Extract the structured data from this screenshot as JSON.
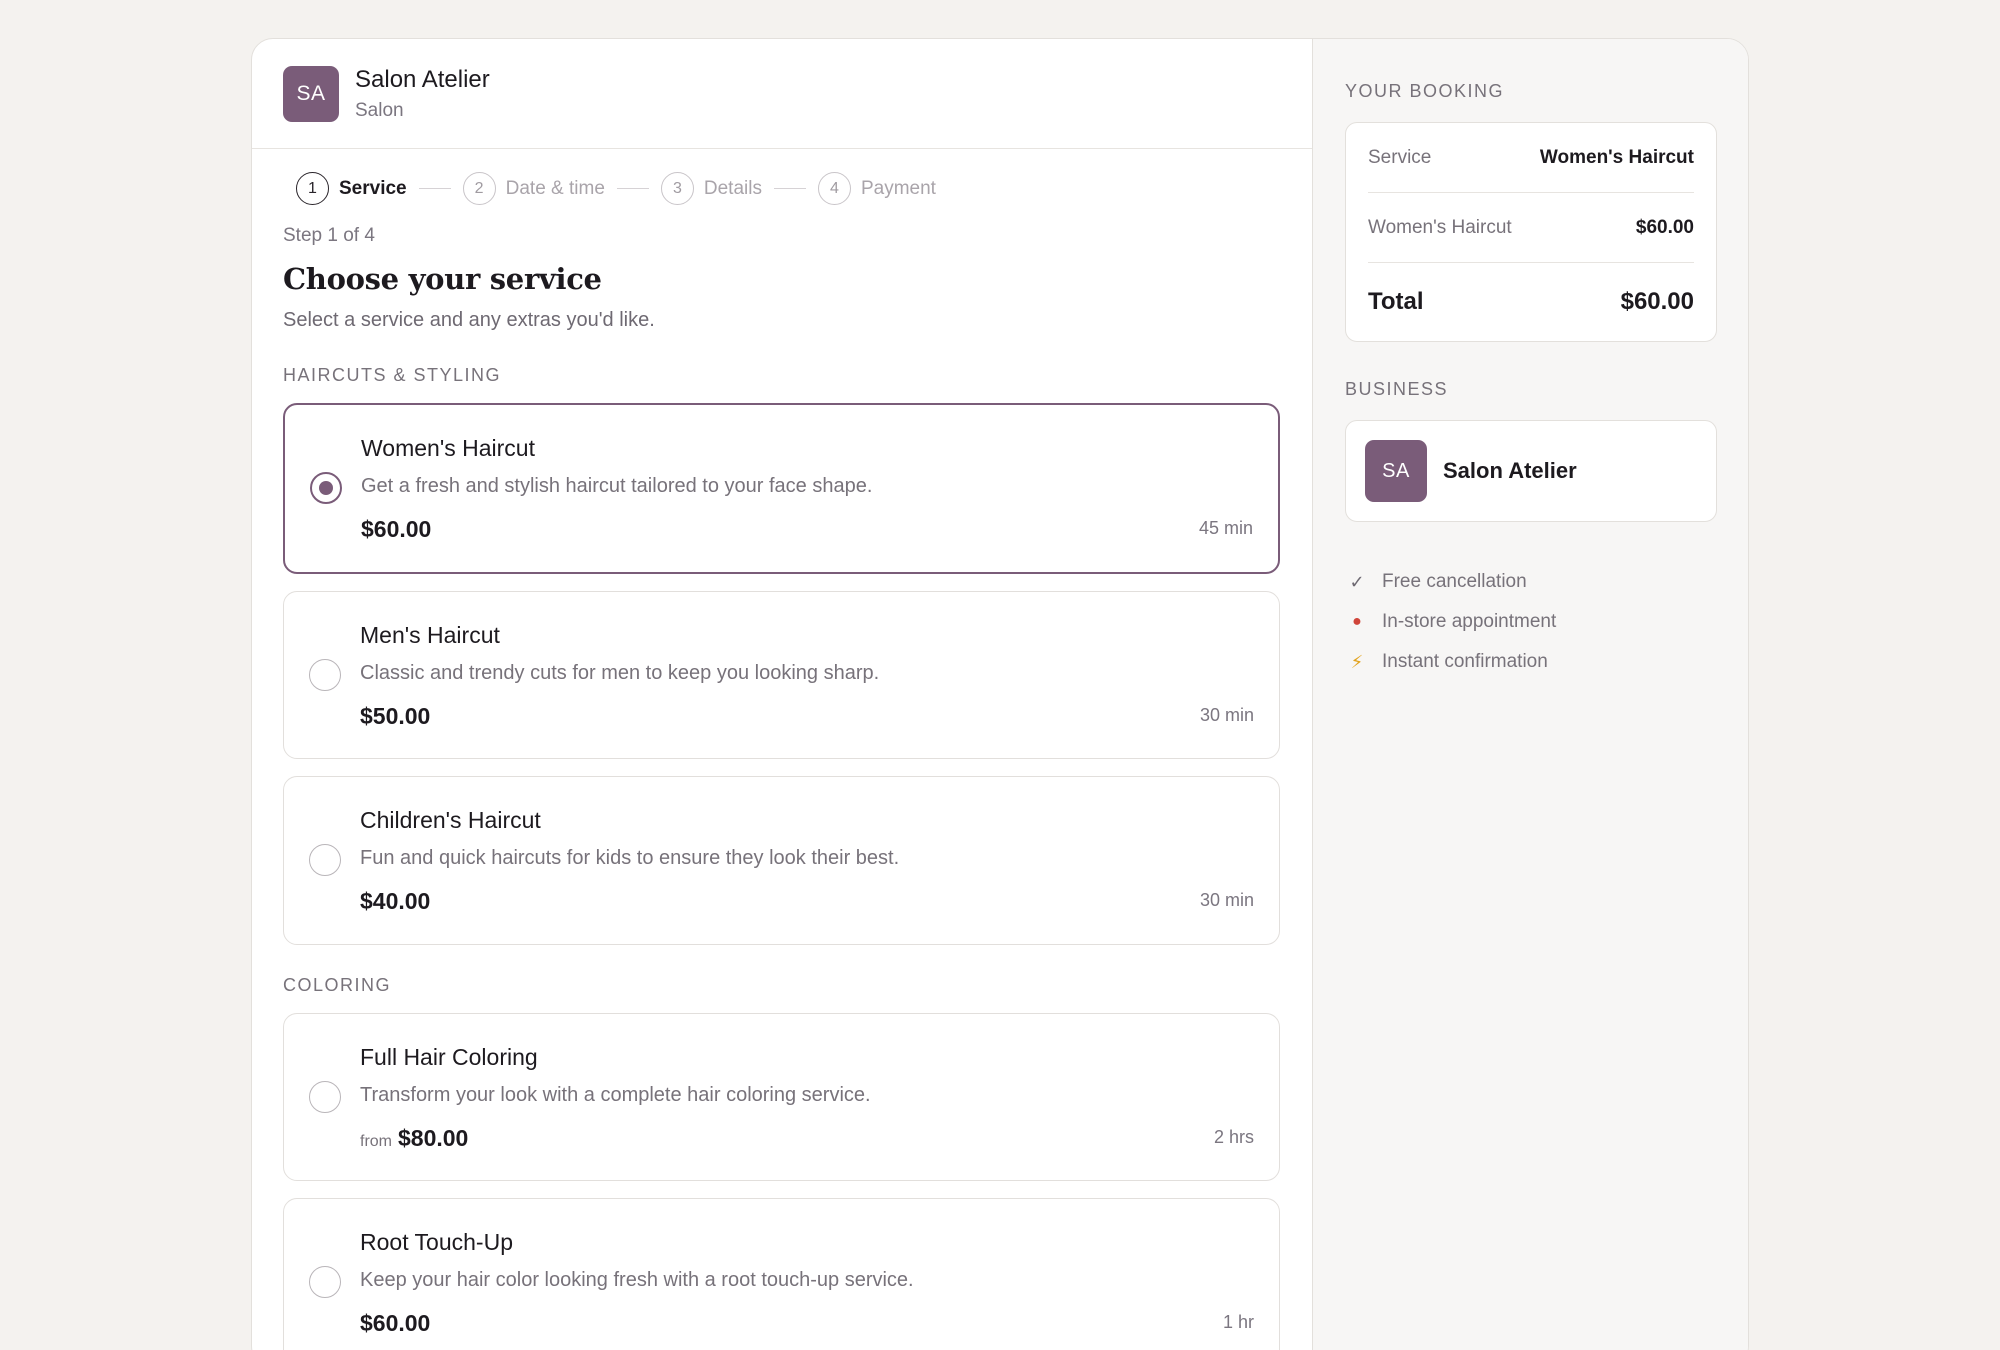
{
  "business": {
    "initials": "SA",
    "name": "Salon Atelier",
    "type": "Salon"
  },
  "steps": [
    {
      "num": "1",
      "label": "Service"
    },
    {
      "num": "2",
      "label": "Date & time"
    },
    {
      "num": "3",
      "label": "Details"
    },
    {
      "num": "4",
      "label": "Payment"
    }
  ],
  "step_count": "Step 1 of 4",
  "page": {
    "title": "Choose your service",
    "subtitle": "Select a service and any extras you'd like."
  },
  "sections": [
    {
      "label": "HAIRCUTS & STYLING",
      "services": [
        {
          "name": "Women's Haircut",
          "desc": "Get a fresh and stylish haircut tailored to your face shape.",
          "price": "$60.00",
          "duration": "45 min"
        },
        {
          "name": "Men's Haircut",
          "desc": "Classic and trendy cuts for men to keep you looking sharp.",
          "price": "$50.00",
          "duration": "30 min"
        },
        {
          "name": "Children's Haircut",
          "desc": "Fun and quick haircuts for kids to ensure they look their best.",
          "price": "$40.00",
          "duration": "30 min"
        }
      ]
    },
    {
      "label": "COLORING",
      "services": [
        {
          "name": "Full Hair Coloring",
          "desc": "Transform your look with a complete hair coloring service.",
          "price_prefix": "from",
          "price": "$80.00",
          "duration": "2 hrs"
        },
        {
          "name": "Root Touch-Up",
          "desc": "Keep your hair color looking fresh with a root touch-up service.",
          "price": "$60.00",
          "duration": "1 hr"
        }
      ]
    }
  ],
  "booking": {
    "heading": "YOUR BOOKING",
    "service_key": "Service",
    "service_value": "Women's Haircut",
    "line_key": "Women's Haircut",
    "line_value": "$60.00",
    "total_key": "Total",
    "total_value": "$60.00"
  },
  "business_section": {
    "heading": "BUSINESS"
  },
  "features": [
    {
      "icon": "check-icon",
      "glyph": "✓",
      "color": "#6e6972",
      "label": "Free cancellation"
    },
    {
      "icon": "location-pin-icon",
      "glyph": "📍",
      "color": "#d0453a",
      "label": "In-store appointment"
    },
    {
      "icon": "lightning-icon",
      "glyph": "⚡",
      "color": "#e2a21b",
      "label": "Instant confirmation"
    }
  ],
  "colors": {
    "accent": "#7a5c79",
    "background": "#f4f2ef"
  }
}
